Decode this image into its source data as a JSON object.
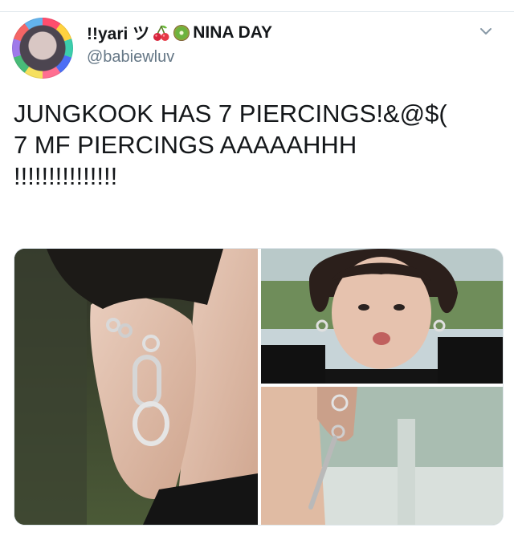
{
  "tweet": {
    "display_name": "!!yari ツ",
    "display_name_suffix": "NINA DAY",
    "handle": "@babiewluv",
    "text_lines": [
      "JUNGKOOK HAS 7 PIERCINGS!&@$(",
      "7 MF PIERCINGS AAAAAHHH",
      "!!!!!!!!!!!!!!!"
    ]
  },
  "icons": {
    "avatar": "profile-avatar",
    "cherry": "cherry-emoji-icon",
    "kiwi": "kiwi-emoji-icon",
    "menu": "chevron-down-icon"
  },
  "colors": {
    "text": "#14171a",
    "secondary_text": "#657786",
    "border": "#e1e8ed"
  }
}
